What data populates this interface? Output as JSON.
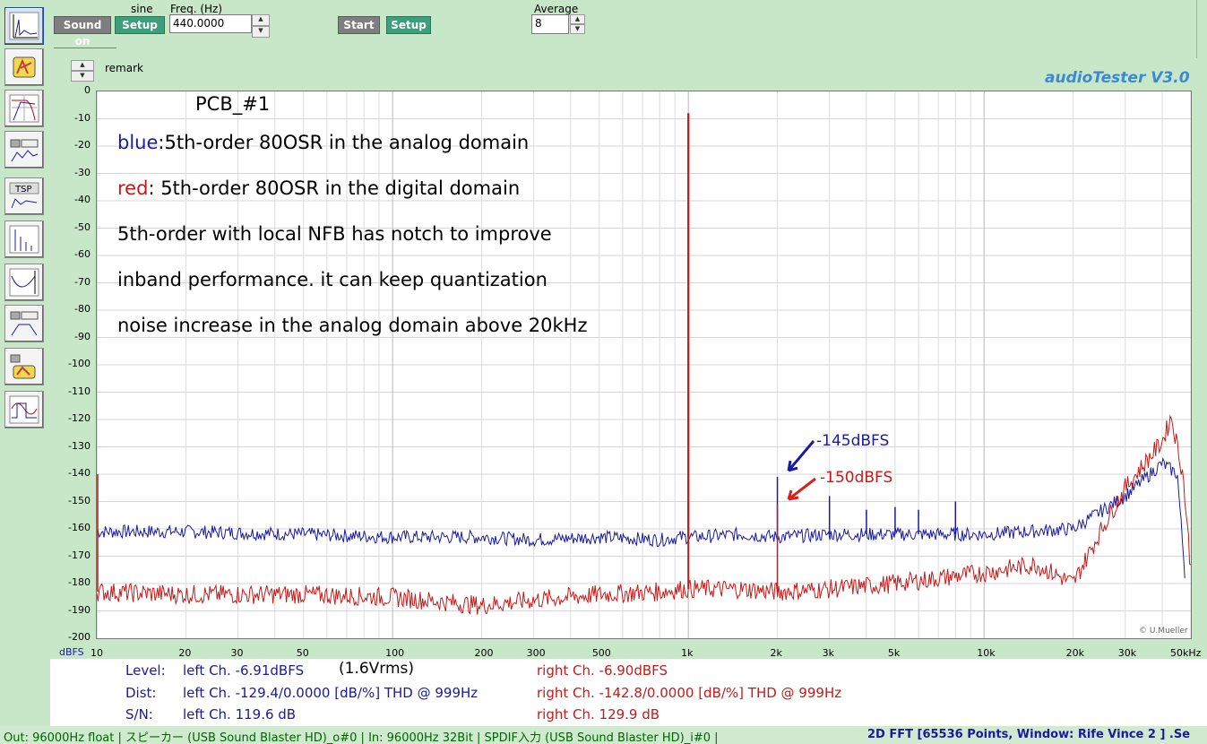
{
  "toolbar": {
    "sound_on": "Sound on",
    "sine_label": "sine",
    "setup1": "Setup",
    "freq_label": "Freq. (Hz)",
    "freq_value": "440.0000",
    "start": "Start",
    "setup2": "Setup",
    "average_label": "Average",
    "average_value": "8"
  },
  "remark_label": "remark",
  "brand": "audioTester  V3.0",
  "copyright": "© U.Mueller",
  "plot": {
    "y_unit": "dBFS",
    "yticks": [
      "0",
      "-10",
      "-20",
      "-30",
      "-40",
      "-50",
      "-60",
      "-70",
      "-80",
      "-90",
      "-100",
      "-110",
      "-120",
      "-130",
      "-140",
      "-150",
      "-160",
      "-170",
      "-180",
      "-190",
      "-200"
    ],
    "xticks": [
      "10",
      "20",
      "30",
      "50",
      "100",
      "200",
      "300",
      "500",
      "1k",
      "2k",
      "3k",
      "5k",
      "10k",
      "20k",
      "30k",
      "50kHz"
    ],
    "annotations": {
      "title": "PCB_#1",
      "line1_prefix": "blue",
      "line1_rest": ":5th-order 80OSR in the analog domain",
      "line2_prefix": "red",
      "line2_rest": ": 5th-order 80OSR in the digital domain",
      "line3": "5th-order with local NFB has notch to improve",
      "line4": "inband performance. it can keep quantization",
      "line5": "noise increase in the analog domain above 20kHz",
      "marker_blue": "-145dBFS",
      "marker_red": "-150dBFS"
    }
  },
  "chart_data": {
    "type": "line",
    "xscale": "log",
    "xlim": [
      10,
      50000
    ],
    "ylim": [
      -200,
      0
    ],
    "ylabel": "dBFS",
    "series": [
      {
        "name": "blue",
        "color": "#1a1aa0",
        "points": [
          [
            10,
            -161
          ],
          [
            20,
            -161
          ],
          [
            50,
            -162
          ],
          [
            100,
            -163
          ],
          [
            200,
            -163
          ],
          [
            300,
            -164
          ],
          [
            500,
            -163
          ],
          [
            800,
            -164
          ],
          [
            950,
            -163
          ],
          [
            1000,
            -8
          ],
          [
            1050,
            -163
          ],
          [
            1500,
            -162
          ],
          [
            2000,
            -163
          ],
          [
            3000,
            -162
          ],
          [
            5000,
            -162
          ],
          [
            10000,
            -162
          ],
          [
            20000,
            -160
          ],
          [
            30000,
            -148
          ],
          [
            40000,
            -136
          ],
          [
            45000,
            -140
          ],
          [
            48000,
            -180
          ]
        ],
        "harmonics": [
          [
            1000,
            -142
          ],
          [
            2000,
            -141
          ],
          [
            3000,
            -148
          ],
          [
            4000,
            -153
          ],
          [
            5000,
            -152
          ],
          [
            6000,
            -153
          ],
          [
            8000,
            -150
          ]
        ]
      },
      {
        "name": "red",
        "color": "#c81818",
        "points": [
          [
            10,
            -183
          ],
          [
            20,
            -184
          ],
          [
            50,
            -184
          ],
          [
            100,
            -185
          ],
          [
            200,
            -188
          ],
          [
            300,
            -186
          ],
          [
            500,
            -184
          ],
          [
            800,
            -183
          ],
          [
            950,
            -182
          ],
          [
            1000,
            -8
          ],
          [
            1050,
            -182
          ],
          [
            1500,
            -182
          ],
          [
            2000,
            -183
          ],
          [
            3000,
            -182
          ],
          [
            5000,
            -180
          ],
          [
            10000,
            -176
          ],
          [
            15000,
            -173
          ],
          [
            20000,
            -180
          ],
          [
            25000,
            -160
          ],
          [
            30000,
            -145
          ],
          [
            40000,
            -128
          ],
          [
            43000,
            -119
          ],
          [
            47000,
            -140
          ],
          [
            50000,
            -175
          ]
        ],
        "harmonics": [
          [
            2000,
            -151
          ]
        ]
      }
    ]
  },
  "readout": {
    "level_label": "Level:",
    "dist_label": "Dist:",
    "sn_label": "S/N:",
    "level_left": "left Ch. -6.91dBFS",
    "level_vrms": "(1.6Vrms)",
    "level_right": "right Ch. -6.90dBFS",
    "dist_left": "left Ch. -129.4/0.0000 [dB/%] THD @ 999Hz",
    "dist_right": "right Ch. -142.8/0.0000 [dB/%] THD @ 999Hz",
    "sn_left": "left Ch. 119.6 dB",
    "sn_right": "right Ch. 129.9 dB"
  },
  "status": {
    "left": "Out: 96000Hz float  | スピーカー (USB Sound Blaster HD)_o#0 | In: 96000Hz 32Bit  | SPDIF入力 (USB Sound Blaster HD)_i#0 |",
    "right": "2D FFT [65536 Points, Window: Rife Vince 2 ]  .Se"
  },
  "colors": {
    "blue": "#1a1aa0",
    "red": "#c81818",
    "brand": "#3a8ad8",
    "bg": "#c8e6c8"
  }
}
